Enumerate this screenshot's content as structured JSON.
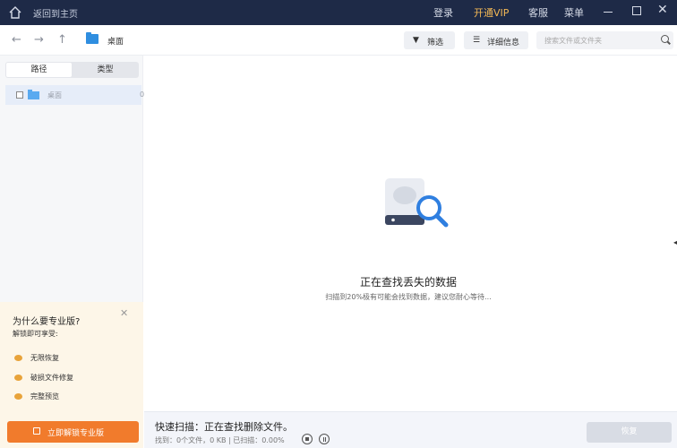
{
  "titlebar": {
    "back_label": "返回到主页",
    "login": "登录",
    "vip": "开通VIP",
    "service": "客服",
    "menu": "菜单",
    "close_glyph": "✕"
  },
  "toolbar": {
    "back_glyph": "←",
    "forward_glyph": "→",
    "up_glyph": "↑",
    "breadcrumb": "桌面",
    "filter_label": "筛选",
    "filter_glyph": "▼",
    "detail_label": "详细信息",
    "detail_glyph": "☰",
    "search_placeholder": "搜索文件或文件夹"
  },
  "sidebar": {
    "tabs": [
      {
        "label": "路径"
      },
      {
        "label": "类型"
      }
    ],
    "tree": [
      {
        "label": "桌面",
        "count": "0"
      }
    ]
  },
  "promo": {
    "title": "为什么要专业版?",
    "subtitle": "解锁即可享受:",
    "close_glyph": "✕",
    "features": [
      {
        "label": "无限恢复",
        "icon": "infinity-icon"
      },
      {
        "label": "破损文件修复",
        "icon": "wrench-icon"
      },
      {
        "label": "完整预览",
        "icon": "eye-icon"
      }
    ],
    "cta": "立即解锁专业版"
  },
  "main": {
    "title": "正在查找丢失的数据",
    "subtitle": "扫描到20%极有可能会找到数据，建议您耐心等待..."
  },
  "footer": {
    "status_title": "快速扫描：正在查找删除文件。",
    "status_stats": "找到：0个文件，0 KB | 已扫描：0.00%",
    "recover_label": "恢复"
  },
  "colors": {
    "titlebar_bg": "#1e2a47",
    "vip": "#f5b955",
    "accent_orange": "#f17b2c",
    "folder_blue": "#2f8ee0",
    "magnifier_blue": "#2f7fe0"
  }
}
